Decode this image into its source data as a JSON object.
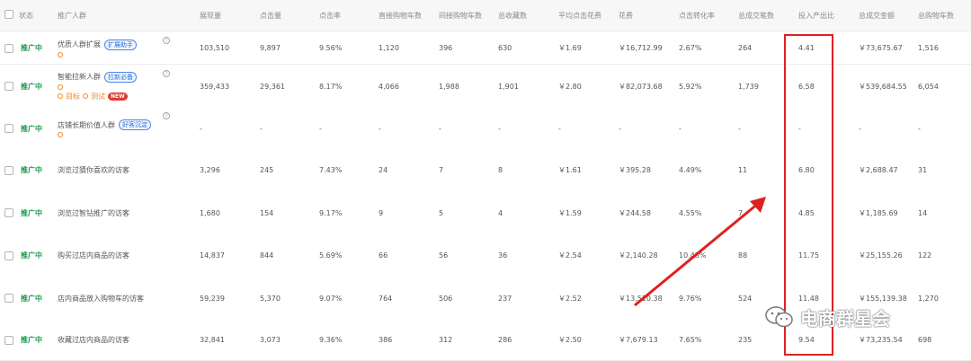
{
  "header": {
    "status_label": "状态",
    "columns": [
      "推广人群",
      "展现量",
      "点击量",
      "点击率",
      "直接购物车数",
      "间接购物车数",
      "总收藏数",
      "平均点击花费",
      "花费",
      "点击转化率",
      "总成交笔数",
      "投入产出比",
      "总成交金额",
      "总购物车数"
    ]
  },
  "rows": [
    {
      "status": "推广中",
      "name": "优质人群扩展",
      "tag": "扩展助手",
      "sub": "",
      "impressions": "103,510",
      "clicks": "9,897",
      "ctr": "9.56%",
      "direct_cart": "1,120",
      "indirect_cart": "396",
      "favorites": "630",
      "avg_cpc": "￥1.69",
      "spend": "￥16,712.99",
      "cvr": "2.67%",
      "orders": "264",
      "roi": "4.41",
      "gmv": "￥73,675.67",
      "total_cart": "1,516"
    },
    {
      "status": "推广中",
      "name": "智能拉新人群",
      "tag": "拉新必备",
      "sub": "目标",
      "sub2": "测试",
      "new": "NEW",
      "impressions": "359,433",
      "clicks": "29,361",
      "ctr": "8.17%",
      "direct_cart": "4,066",
      "indirect_cart": "1,988",
      "favorites": "1,901",
      "avg_cpc": "￥2.80",
      "spend": "￥82,073.68",
      "cvr": "5.92%",
      "orders": "1,739",
      "roi": "6.58",
      "gmv": "￥539,684.55",
      "total_cart": "6,054"
    },
    {
      "status": "推广中",
      "name": "店铺长期价值人群",
      "tag": "好客沉淀",
      "sub": "",
      "impressions": "-",
      "clicks": "-",
      "ctr": "-",
      "direct_cart": "-",
      "indirect_cart": "-",
      "favorites": "-",
      "avg_cpc": "-",
      "spend": "-",
      "cvr": "-",
      "orders": "-",
      "roi": "-",
      "gmv": "-",
      "total_cart": "-"
    },
    {
      "status": "推广中",
      "name": "浏览过猜你喜欢的访客",
      "impressions": "3,296",
      "clicks": "245",
      "ctr": "7.43%",
      "direct_cart": "24",
      "indirect_cart": "7",
      "favorites": "8",
      "avg_cpc": "￥1.61",
      "spend": "￥395.28",
      "cvr": "4.49%",
      "orders": "11",
      "roi": "6.80",
      "gmv": "￥2,688.47",
      "total_cart": "31"
    },
    {
      "status": "推广中",
      "name": "浏览过智钻推广的访客",
      "impressions": "1,680",
      "clicks": "154",
      "ctr": "9.17%",
      "direct_cart": "9",
      "indirect_cart": "5",
      "favorites": "4",
      "avg_cpc": "￥1.59",
      "spend": "￥244.58",
      "cvr": "4.55%",
      "orders": "7",
      "roi": "4.85",
      "gmv": "￥1,185.69",
      "total_cart": "14"
    },
    {
      "status": "推广中",
      "name": "购买过店内商品的访客",
      "impressions": "14,837",
      "clicks": "844",
      "ctr": "5.69%",
      "direct_cart": "66",
      "indirect_cart": "56",
      "favorites": "36",
      "avg_cpc": "￥2.54",
      "spend": "￥2,140.28",
      "cvr": "10.43%",
      "orders": "88",
      "roi": "11.75",
      "gmv": "￥25,155.26",
      "total_cart": "122"
    },
    {
      "status": "推广中",
      "name": "店内商品放入购物车的访客",
      "impressions": "59,239",
      "clicks": "5,370",
      "ctr": "9.07%",
      "direct_cart": "764",
      "indirect_cart": "506",
      "favorites": "237",
      "avg_cpc": "￥2.52",
      "spend": "￥13,510.38",
      "cvr": "9.76%",
      "orders": "524",
      "roi": "11.48",
      "gmv": "￥155,139.38",
      "total_cart": "1,270"
    },
    {
      "status": "推广中",
      "name": "收藏过店内商品的访客",
      "impressions": "32,841",
      "clicks": "3,073",
      "ctr": "9.36%",
      "direct_cart": "386",
      "indirect_cart": "312",
      "favorites": "286",
      "avg_cpc": "￥2.50",
      "spend": "￥7,679.13",
      "cvr": "7.65%",
      "orders": "235",
      "roi": "9.54",
      "gmv": "￥73,235.54",
      "total_cart": "698"
    }
  ],
  "watermark": "电商群星会",
  "colors": {
    "status_green": "#1a9a4a",
    "annotation_red": "#e02020",
    "tag_blue": "#2f6fd8",
    "accent_orange": "#f08a24"
  }
}
